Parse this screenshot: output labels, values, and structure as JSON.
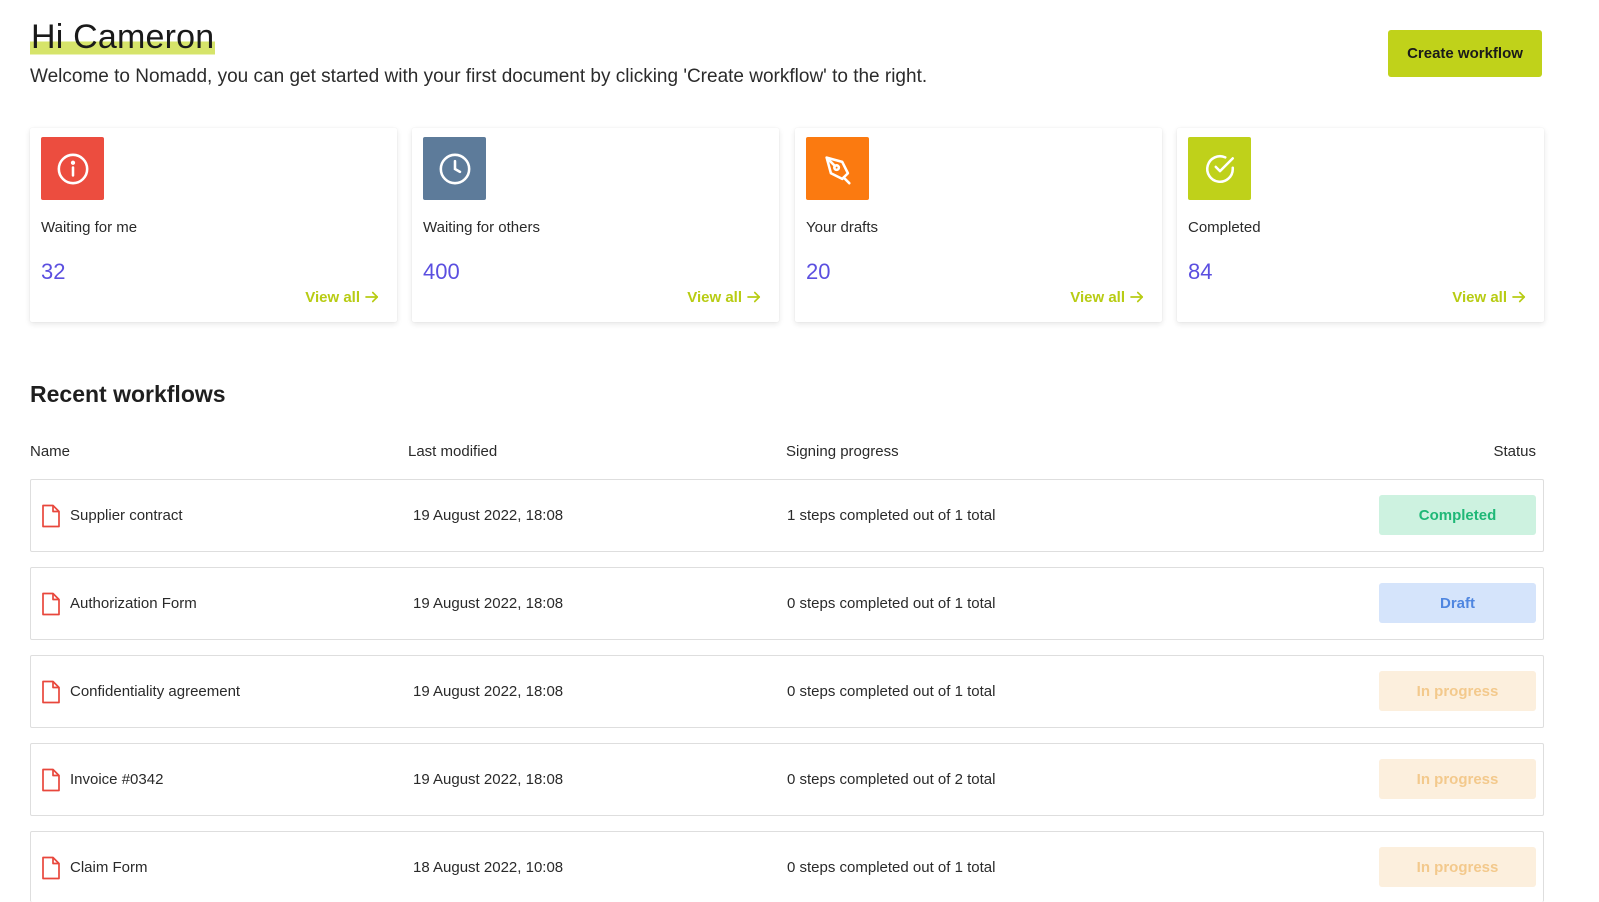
{
  "header": {
    "greeting": "Hi Cameron",
    "welcome": "Welcome to Nomadd, you can get started with your first document by clicking 'Create workflow' to the right.",
    "create_button": "Create workflow"
  },
  "cards": [
    {
      "label": "Waiting for me",
      "count": "32",
      "view_all": "View all",
      "icon": "info-icon",
      "color": "#ec4d3f"
    },
    {
      "label": "Waiting for others",
      "count": "400",
      "view_all": "View all",
      "icon": "clock-icon",
      "color": "#5d7b9a"
    },
    {
      "label": "Your drafts",
      "count": "20",
      "view_all": "View all",
      "icon": "pen-tool-icon",
      "color": "#fb7a10"
    },
    {
      "label": "Completed",
      "count": "84",
      "view_all": "View all",
      "icon": "check-circle-icon",
      "color": "#bfd11a"
    }
  ],
  "recent": {
    "title": "Recent workflows",
    "columns": {
      "name": "Name",
      "last_modified": "Last modified",
      "signing_progress": "Signing progress",
      "status": "Status"
    },
    "rows": [
      {
        "name": "Supplier contract",
        "date": "19 August 2022, 18:08",
        "progress": "1 steps completed out of 1 total",
        "status": "Completed"
      },
      {
        "name": "Authorization Form",
        "date": "19 August 2022, 18:08",
        "progress": "0 steps completed out of 1 total",
        "status": "Draft"
      },
      {
        "name": "Confidentiality agreement",
        "date": "19 August 2022, 18:08",
        "progress": "0 steps completed out of 1 total",
        "status": "In progress"
      },
      {
        "name": "Invoice #0342",
        "date": "19 August 2022, 18:08",
        "progress": "0 steps completed out of 2 total",
        "status": "In progress"
      },
      {
        "name": "Claim Form",
        "date": "18 August 2022, 10:08",
        "progress": "0 steps completed out of 1 total",
        "status": "In progress"
      }
    ]
  },
  "colors": {
    "accent": "#c0d21a",
    "count_text": "#5b4fe0",
    "file_icon": "#e8473c"
  }
}
